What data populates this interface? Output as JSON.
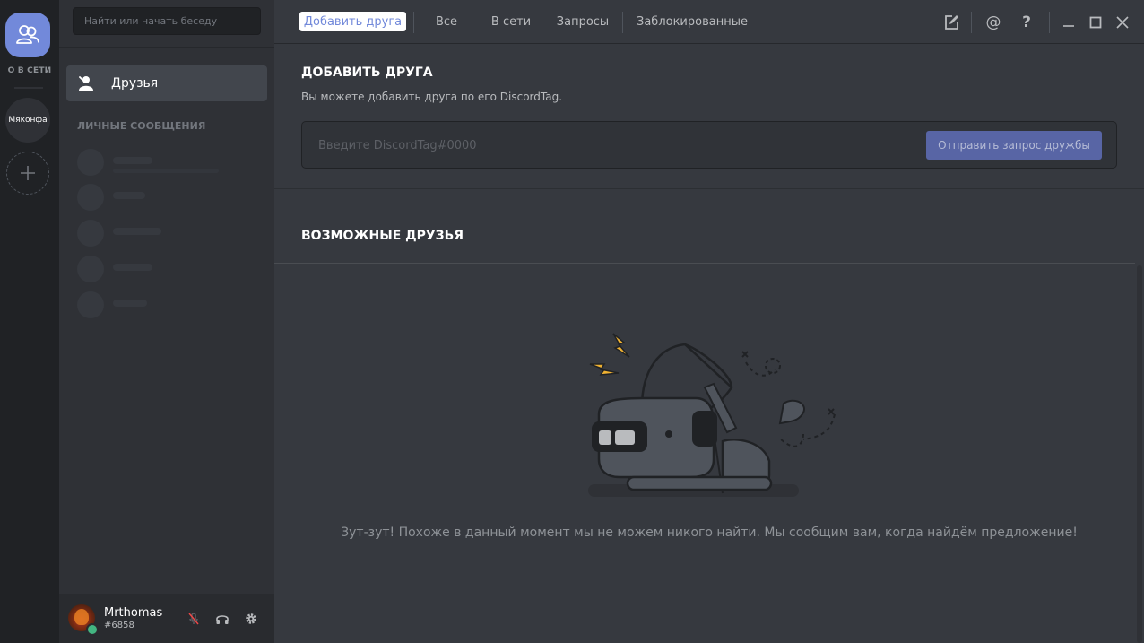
{
  "rail": {
    "online_label": "О В СЕТИ",
    "server_name": "Мяконфа"
  },
  "sidebar": {
    "search_placeholder": "Найти или начать беседу",
    "friends_label": "Друзья",
    "dm_header": "ЛИЧНЫЕ СООБЩЕНИЯ"
  },
  "user": {
    "name": "Mrthomas",
    "tag": "#6858",
    "status_color": "#43b581"
  },
  "tabs": [
    {
      "label": "Добавить друга",
      "active": true
    },
    {
      "label": "Все"
    },
    {
      "label": "В сети"
    },
    {
      "label": "Запросы"
    },
    {
      "label": "Заблокированные"
    }
  ],
  "toolbar_icons": [
    "new-group-dm-icon",
    "mention-icon",
    "help-icon",
    "minimize-icon",
    "maximize-icon",
    "close-icon"
  ],
  "add_friend": {
    "title": "ДОБАВИТЬ ДРУГА",
    "description": "Вы можете добавить друга по его DiscordTag.",
    "input_placeholder": "Введите DiscordTag#0000",
    "button_label": "Отправить запрос дружбы"
  },
  "possible_friends": {
    "title": "ВОЗМОЖНЫЕ ДРУЗЬЯ",
    "empty_message": "Зут-зут! Похоже в данный момент мы не можем никого найти. Мы сообщим вам, когда найдём предложение!"
  },
  "colors": {
    "accent": "#7289da",
    "background": "#36393f",
    "sidebar": "#2f3136",
    "rail": "#202225"
  }
}
